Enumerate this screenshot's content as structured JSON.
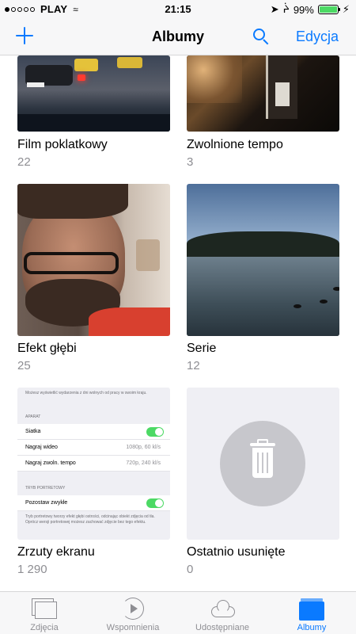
{
  "status_bar": {
    "carrier": "PLAY",
    "time": "21:15",
    "battery_percent": "99%",
    "battery_level": 0.99
  },
  "nav": {
    "title": "Albumy",
    "edit_label": "Edycja"
  },
  "albums": [
    {
      "title": "Film poklatkowy",
      "count": "22"
    },
    {
      "title": "Zwolnione tempo",
      "count": "3"
    },
    {
      "title": "Efekt głębi",
      "count": "25"
    },
    {
      "title": "Serie",
      "count": "12"
    },
    {
      "title": "Zrzuty ekranu",
      "count": "1 290"
    },
    {
      "title": "Ostatnio usunięte",
      "count": "0"
    }
  ],
  "screenshot_thumb": {
    "top_note": "Możesz wyświetlić wydarzenia z dni wolnych od pracy w swoim kraju.",
    "section_camera": "APARAT",
    "grid_label": "Siatka",
    "video_label": "Nagraj wideo",
    "video_value": "1080p, 60 kl/s",
    "slomo_label": "Nagraj zwoln. tempo",
    "slomo_value": "720p, 240 kl/s",
    "section_portrait": "TRYB PORTRETOWY",
    "keep_normal_label": "Pozostaw zwykłe",
    "portrait_note": "Tryb portretowy tworzy efekt głębi ostrości, odcinając obiekt zdjęcia od tła. Oprócz wersji portretowej możesz zachować zdjęcie bez tego efektu."
  },
  "tabs": [
    {
      "label": "Zdjęcia",
      "active": false
    },
    {
      "label": "Wspomnienia",
      "active": false
    },
    {
      "label": "Udostępniane",
      "active": false
    },
    {
      "label": "Albumy",
      "active": true
    }
  ],
  "colors": {
    "accent": "#0a7aff",
    "secondary_text": "#8e8e93",
    "toggle_on": "#4cd964"
  }
}
